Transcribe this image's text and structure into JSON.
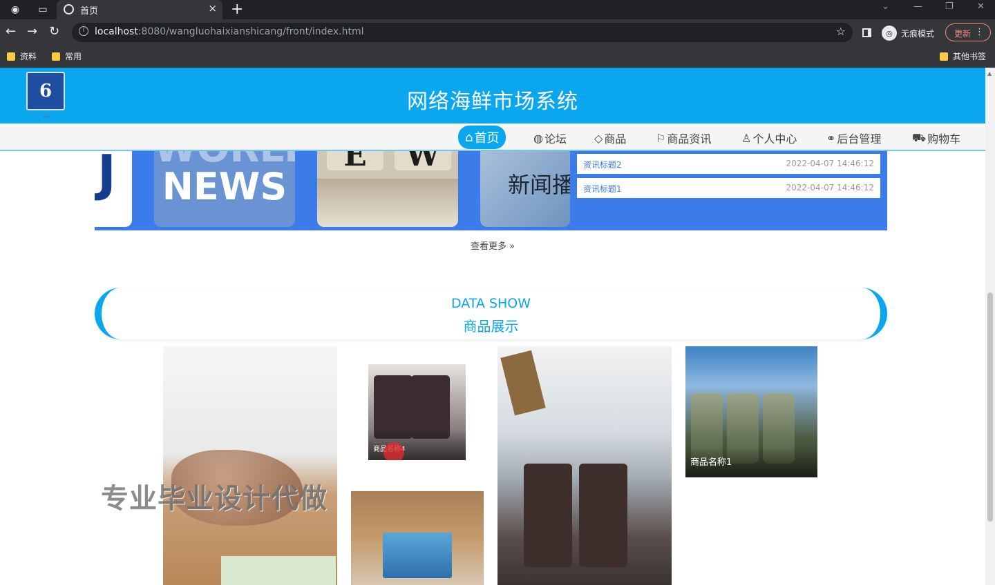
{
  "browser": {
    "tab_title": "首页",
    "url_host": "localhost",
    "url_rest": ":8080/wangluohaixianshicang/front/index.html",
    "incognito_label": "无痕模式",
    "update_label": "更新",
    "bookmarks": [
      {
        "label": "资料"
      },
      {
        "label": "常用"
      }
    ],
    "other_bookmarks": "其他书签"
  },
  "site": {
    "title": "网络海鲜市场系统",
    "nav": [
      {
        "icon": "⌂",
        "label": "首页"
      },
      {
        "icon": "◍",
        "label": "论坛"
      },
      {
        "icon": "◇",
        "label": "商品"
      },
      {
        "icon": "⚐",
        "label": "商品资讯"
      },
      {
        "icon": "♙",
        "label": "个人中心"
      },
      {
        "icon": "⚭",
        "label": "后台管理"
      },
      {
        "icon": "⛟",
        "label": "购物车"
      }
    ]
  },
  "news": {
    "items": [
      {
        "title": "资讯标题2",
        "date": "2022-04-07 14:46:12"
      },
      {
        "title": "资讯标题1",
        "date": "2022-04-07 14:46:12"
      }
    ],
    "image_texts": {
      "j": "J",
      "world": "WORLD",
      "news": "NEWS",
      "e": "E",
      "w": "W",
      "broadcast": "新闻播"
    },
    "more_label": "查看更多"
  },
  "data_show": {
    "title_en": "DATA SHOW",
    "title_zh": "商品展示",
    "products": [
      {
        "name": "商品名称4"
      },
      {
        "name": "商品名称1"
      }
    ]
  },
  "watermark": "专业毕业设计代做",
  "colors": {
    "accent": "#0aa6ee",
    "news_panel": "#3c7bea"
  }
}
